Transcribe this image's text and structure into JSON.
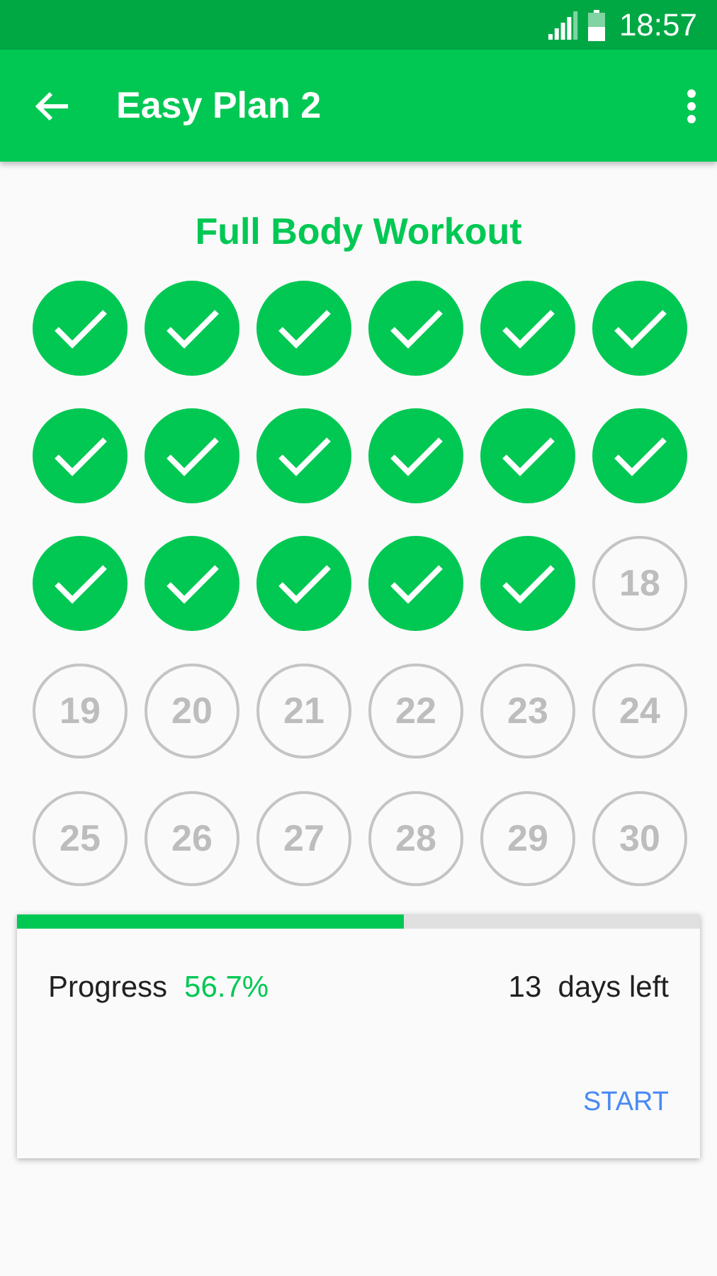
{
  "status_bar": {
    "time": "18:57"
  },
  "app_bar": {
    "title": "Easy Plan 2"
  },
  "workout_title": "Full Body Workout",
  "days": [
    {
      "done": true
    },
    {
      "done": true
    },
    {
      "done": true
    },
    {
      "done": true
    },
    {
      "done": true
    },
    {
      "done": true
    },
    {
      "done": true
    },
    {
      "done": true
    },
    {
      "done": true
    },
    {
      "done": true
    },
    {
      "done": true
    },
    {
      "done": true
    },
    {
      "done": true
    },
    {
      "done": true
    },
    {
      "done": true
    },
    {
      "done": true
    },
    {
      "done": true
    },
    {
      "label": "18",
      "done": false
    },
    {
      "label": "19",
      "done": false
    },
    {
      "label": "20",
      "done": false
    },
    {
      "label": "21",
      "done": false
    },
    {
      "label": "22",
      "done": false
    },
    {
      "label": "23",
      "done": false
    },
    {
      "label": "24",
      "done": false
    },
    {
      "label": "25",
      "done": false
    },
    {
      "label": "26",
      "done": false
    },
    {
      "label": "27",
      "done": false
    },
    {
      "label": "28",
      "done": false
    },
    {
      "label": "29",
      "done": false
    },
    {
      "label": "30",
      "done": false
    }
  ],
  "progress": {
    "level": 0.567,
    "label": "Progress",
    "value": "56.7%",
    "days_left": "13  days left",
    "button": "START"
  }
}
